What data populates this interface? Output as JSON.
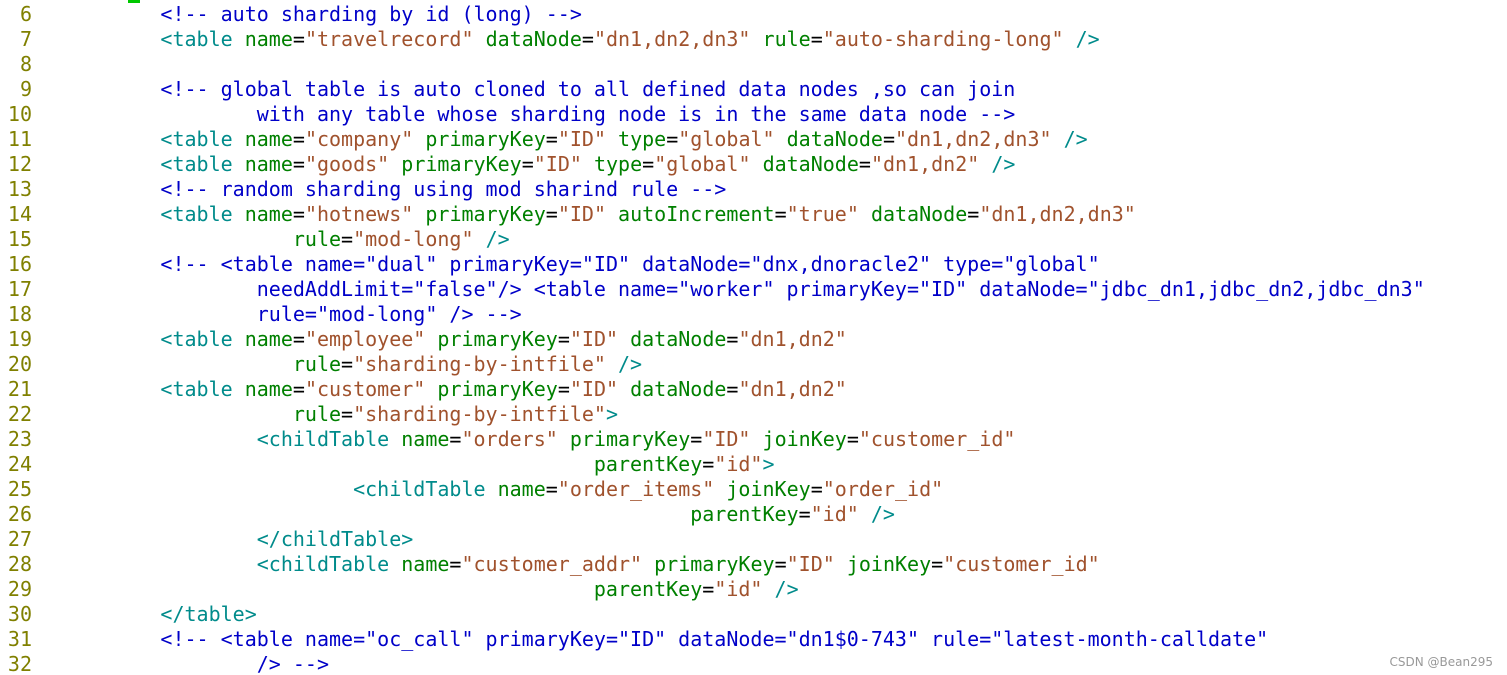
{
  "editor": {
    "lines": [
      {
        "number": "6",
        "indent": "          ",
        "tokens": [
          {
            "t": "comment",
            "v": "<!-- auto sharding by id (long) -->"
          }
        ]
      },
      {
        "number": "7",
        "indent": "          ",
        "tokens": [
          {
            "t": "tag",
            "v": "<table"
          },
          {
            "t": "text",
            "v": " "
          },
          {
            "t": "attr",
            "v": "name"
          },
          {
            "t": "eq",
            "v": "="
          },
          {
            "t": "val",
            "v": "\"travelrecord\""
          },
          {
            "t": "text",
            "v": " "
          },
          {
            "t": "attr",
            "v": "dataNode"
          },
          {
            "t": "eq",
            "v": "="
          },
          {
            "t": "val",
            "v": "\"dn1,dn2,dn3\""
          },
          {
            "t": "text",
            "v": " "
          },
          {
            "t": "attr",
            "v": "rule"
          },
          {
            "t": "eq",
            "v": "="
          },
          {
            "t": "val",
            "v": "\"auto-sharding-long\""
          },
          {
            "t": "text",
            "v": " "
          },
          {
            "t": "tag",
            "v": "/>"
          }
        ]
      },
      {
        "number": "8",
        "indent": "",
        "tokens": []
      },
      {
        "number": "9",
        "indent": "          ",
        "tokens": [
          {
            "t": "comment",
            "v": "<!-- global table is auto cloned to all defined data nodes ,so can join"
          }
        ]
      },
      {
        "number": "10",
        "indent": "                  ",
        "tokens": [
          {
            "t": "comment",
            "v": "with any table whose sharding node is in the same data node -->"
          }
        ]
      },
      {
        "number": "11",
        "indent": "          ",
        "tokens": [
          {
            "t": "tag",
            "v": "<table"
          },
          {
            "t": "text",
            "v": " "
          },
          {
            "t": "attr",
            "v": "name"
          },
          {
            "t": "eq",
            "v": "="
          },
          {
            "t": "val",
            "v": "\"company\""
          },
          {
            "t": "text",
            "v": " "
          },
          {
            "t": "attr",
            "v": "primaryKey"
          },
          {
            "t": "eq",
            "v": "="
          },
          {
            "t": "val",
            "v": "\"ID\""
          },
          {
            "t": "text",
            "v": " "
          },
          {
            "t": "attr",
            "v": "type"
          },
          {
            "t": "eq",
            "v": "="
          },
          {
            "t": "val",
            "v": "\"global\""
          },
          {
            "t": "text",
            "v": " "
          },
          {
            "t": "attr",
            "v": "dataNode"
          },
          {
            "t": "eq",
            "v": "="
          },
          {
            "t": "val",
            "v": "\"dn1,dn2,dn3\""
          },
          {
            "t": "text",
            "v": " "
          },
          {
            "t": "tag",
            "v": "/>"
          }
        ]
      },
      {
        "number": "12",
        "indent": "          ",
        "tokens": [
          {
            "t": "tag",
            "v": "<table"
          },
          {
            "t": "text",
            "v": " "
          },
          {
            "t": "attr",
            "v": "name"
          },
          {
            "t": "eq",
            "v": "="
          },
          {
            "t": "val",
            "v": "\"goods\""
          },
          {
            "t": "text",
            "v": " "
          },
          {
            "t": "attr",
            "v": "primaryKey"
          },
          {
            "t": "eq",
            "v": "="
          },
          {
            "t": "val",
            "v": "\"ID\""
          },
          {
            "t": "text",
            "v": " "
          },
          {
            "t": "attr",
            "v": "type"
          },
          {
            "t": "eq",
            "v": "="
          },
          {
            "t": "val",
            "v": "\"global\""
          },
          {
            "t": "text",
            "v": " "
          },
          {
            "t": "attr",
            "v": "dataNode"
          },
          {
            "t": "eq",
            "v": "="
          },
          {
            "t": "val",
            "v": "\"dn1,dn2\""
          },
          {
            "t": "text",
            "v": " "
          },
          {
            "t": "tag",
            "v": "/>"
          }
        ]
      },
      {
        "number": "13",
        "indent": "          ",
        "tokens": [
          {
            "t": "comment",
            "v": "<!-- random sharding using mod sharind rule -->"
          }
        ]
      },
      {
        "number": "14",
        "indent": "          ",
        "tokens": [
          {
            "t": "tag",
            "v": "<table"
          },
          {
            "t": "text",
            "v": " "
          },
          {
            "t": "attr",
            "v": "name"
          },
          {
            "t": "eq",
            "v": "="
          },
          {
            "t": "val",
            "v": "\"hotnews\""
          },
          {
            "t": "text",
            "v": " "
          },
          {
            "t": "attr",
            "v": "primaryKey"
          },
          {
            "t": "eq",
            "v": "="
          },
          {
            "t": "val",
            "v": "\"ID\""
          },
          {
            "t": "text",
            "v": " "
          },
          {
            "t": "attr",
            "v": "autoIncrement"
          },
          {
            "t": "eq",
            "v": "="
          },
          {
            "t": "val",
            "v": "\"true\""
          },
          {
            "t": "text",
            "v": " "
          },
          {
            "t": "attr",
            "v": "dataNode"
          },
          {
            "t": "eq",
            "v": "="
          },
          {
            "t": "val",
            "v": "\"dn1,dn2,dn3\""
          }
        ]
      },
      {
        "number": "15",
        "indent": "                     ",
        "tokens": [
          {
            "t": "attr",
            "v": "rule"
          },
          {
            "t": "eq",
            "v": "="
          },
          {
            "t": "val",
            "v": "\"mod-long\""
          },
          {
            "t": "text",
            "v": " "
          },
          {
            "t": "tag",
            "v": "/>"
          }
        ]
      },
      {
        "number": "16",
        "indent": "          ",
        "tokens": [
          {
            "t": "comment",
            "v": "<!-- <table name=\"dual\" primaryKey=\"ID\" dataNode=\"dnx,dnoracle2\" type=\"global\""
          }
        ]
      },
      {
        "number": "17",
        "indent": "                  ",
        "tokens": [
          {
            "t": "comment",
            "v": "needAddLimit=\"false\"/> <table name=\"worker\" primaryKey=\"ID\" dataNode=\"jdbc_dn1,jdbc_dn2,jdbc_dn3\""
          }
        ]
      },
      {
        "number": "18",
        "indent": "                  ",
        "tokens": [
          {
            "t": "comment",
            "v": "rule=\"mod-long\" /> -->"
          }
        ]
      },
      {
        "number": "19",
        "indent": "          ",
        "tokens": [
          {
            "t": "tag",
            "v": "<table"
          },
          {
            "t": "text",
            "v": " "
          },
          {
            "t": "attr",
            "v": "name"
          },
          {
            "t": "eq",
            "v": "="
          },
          {
            "t": "val",
            "v": "\"employee\""
          },
          {
            "t": "text",
            "v": " "
          },
          {
            "t": "attr",
            "v": "primaryKey"
          },
          {
            "t": "eq",
            "v": "="
          },
          {
            "t": "val",
            "v": "\"ID\""
          },
          {
            "t": "text",
            "v": " "
          },
          {
            "t": "attr",
            "v": "dataNode"
          },
          {
            "t": "eq",
            "v": "="
          },
          {
            "t": "val",
            "v": "\"dn1,dn2\""
          }
        ]
      },
      {
        "number": "20",
        "indent": "                     ",
        "tokens": [
          {
            "t": "attr",
            "v": "rule"
          },
          {
            "t": "eq",
            "v": "="
          },
          {
            "t": "val",
            "v": "\"sharding-by-intfile\""
          },
          {
            "t": "text",
            "v": " "
          },
          {
            "t": "tag",
            "v": "/>"
          }
        ]
      },
      {
        "number": "21",
        "indent": "          ",
        "tokens": [
          {
            "t": "tag",
            "v": "<table"
          },
          {
            "t": "text",
            "v": " "
          },
          {
            "t": "attr",
            "v": "name"
          },
          {
            "t": "eq",
            "v": "="
          },
          {
            "t": "val",
            "v": "\"customer\""
          },
          {
            "t": "text",
            "v": " "
          },
          {
            "t": "attr",
            "v": "primaryKey"
          },
          {
            "t": "eq",
            "v": "="
          },
          {
            "t": "val",
            "v": "\"ID\""
          },
          {
            "t": "text",
            "v": " "
          },
          {
            "t": "attr",
            "v": "dataNode"
          },
          {
            "t": "eq",
            "v": "="
          },
          {
            "t": "val",
            "v": "\"dn1,dn2\""
          }
        ]
      },
      {
        "number": "22",
        "indent": "                     ",
        "tokens": [
          {
            "t": "attr",
            "v": "rule"
          },
          {
            "t": "eq",
            "v": "="
          },
          {
            "t": "val",
            "v": "\"sharding-by-intfile\""
          },
          {
            "t": "tag",
            "v": ">"
          }
        ]
      },
      {
        "number": "23",
        "indent": "                  ",
        "tokens": [
          {
            "t": "tag",
            "v": "<childTable"
          },
          {
            "t": "text",
            "v": " "
          },
          {
            "t": "attr",
            "v": "name"
          },
          {
            "t": "eq",
            "v": "="
          },
          {
            "t": "val",
            "v": "\"orders\""
          },
          {
            "t": "text",
            "v": " "
          },
          {
            "t": "attr",
            "v": "primaryKey"
          },
          {
            "t": "eq",
            "v": "="
          },
          {
            "t": "val",
            "v": "\"ID\""
          },
          {
            "t": "text",
            "v": " "
          },
          {
            "t": "attr",
            "v": "joinKey"
          },
          {
            "t": "eq",
            "v": "="
          },
          {
            "t": "val",
            "v": "\"customer_id\""
          }
        ]
      },
      {
        "number": "24",
        "indent": "                                              ",
        "tokens": [
          {
            "t": "attr",
            "v": "parentKey"
          },
          {
            "t": "eq",
            "v": "="
          },
          {
            "t": "val",
            "v": "\"id\""
          },
          {
            "t": "tag",
            "v": ">"
          }
        ]
      },
      {
        "number": "25",
        "indent": "                          ",
        "tokens": [
          {
            "t": "tag",
            "v": "<childTable"
          },
          {
            "t": "text",
            "v": " "
          },
          {
            "t": "attr",
            "v": "name"
          },
          {
            "t": "eq",
            "v": "="
          },
          {
            "t": "val",
            "v": "\"order_items\""
          },
          {
            "t": "text",
            "v": " "
          },
          {
            "t": "attr",
            "v": "joinKey"
          },
          {
            "t": "eq",
            "v": "="
          },
          {
            "t": "val",
            "v": "\"order_id\""
          }
        ]
      },
      {
        "number": "26",
        "indent": "                                                      ",
        "tokens": [
          {
            "t": "attr",
            "v": "parentKey"
          },
          {
            "t": "eq",
            "v": "="
          },
          {
            "t": "val",
            "v": "\"id\""
          },
          {
            "t": "text",
            "v": " "
          },
          {
            "t": "tag",
            "v": "/>"
          }
        ]
      },
      {
        "number": "27",
        "indent": "                  ",
        "tokens": [
          {
            "t": "tag",
            "v": "</childTable>"
          }
        ]
      },
      {
        "number": "28",
        "indent": "                  ",
        "tokens": [
          {
            "t": "tag",
            "v": "<childTable"
          },
          {
            "t": "text",
            "v": " "
          },
          {
            "t": "attr",
            "v": "name"
          },
          {
            "t": "eq",
            "v": "="
          },
          {
            "t": "val",
            "v": "\"customer_addr\""
          },
          {
            "t": "text",
            "v": " "
          },
          {
            "t": "attr",
            "v": "primaryKey"
          },
          {
            "t": "eq",
            "v": "="
          },
          {
            "t": "val",
            "v": "\"ID\""
          },
          {
            "t": "text",
            "v": " "
          },
          {
            "t": "attr",
            "v": "joinKey"
          },
          {
            "t": "eq",
            "v": "="
          },
          {
            "t": "val",
            "v": "\"customer_id\""
          }
        ]
      },
      {
        "number": "29",
        "indent": "                                              ",
        "tokens": [
          {
            "t": "attr",
            "v": "parentKey"
          },
          {
            "t": "eq",
            "v": "="
          },
          {
            "t": "val",
            "v": "\"id\""
          },
          {
            "t": "text",
            "v": " "
          },
          {
            "t": "tag",
            "v": "/>"
          }
        ]
      },
      {
        "number": "30",
        "indent": "          ",
        "tokens": [
          {
            "t": "tag",
            "v": "</table>"
          }
        ]
      },
      {
        "number": "31",
        "indent": "          ",
        "tokens": [
          {
            "t": "comment",
            "v": "<!-- <table name=\"oc_call\" primaryKey=\"ID\" dataNode=\"dn1$0-743\" rule=\"latest-month-calldate\""
          }
        ]
      },
      {
        "number": "32",
        "indent": "                  ",
        "tokens": [
          {
            "t": "comment",
            "v": "/> -->"
          }
        ]
      }
    ]
  },
  "watermark": {
    "text": "CSDN @Bean295"
  },
  "colors": {
    "line_number": "#808000",
    "comment": "#0000c8",
    "tag": "#008b8b",
    "attribute": "#008000",
    "value": "#a0522d",
    "cursor": "#00c800"
  }
}
